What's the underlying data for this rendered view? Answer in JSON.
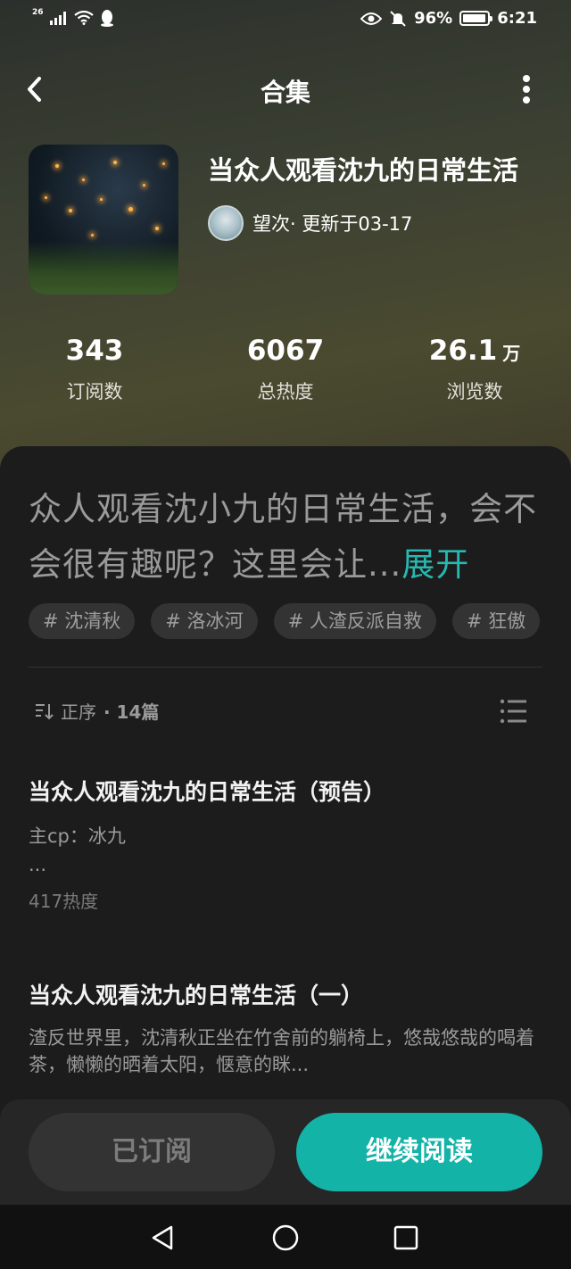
{
  "status_bar": {
    "network": "26",
    "battery_percent": "96%",
    "battery_level": 0.96,
    "time": "6:21",
    "icons": [
      "signal-icon",
      "wifi-icon",
      "qq-icon",
      "eye-icon",
      "mute-bell-icon",
      "battery-icon"
    ]
  },
  "header": {
    "back_icon": "chevron-left-icon",
    "title": "合集",
    "more_icon": "more-vertical-icon"
  },
  "collection": {
    "title": "当众人观看沈九的日常生活",
    "author": "望次",
    "updated": "· 更新于03-17"
  },
  "stats": [
    {
      "value": "343",
      "unit": "",
      "label": "订阅数"
    },
    {
      "value": "6067",
      "unit": "",
      "label": "总热度"
    },
    {
      "value": "26.1",
      "unit": "万",
      "label": "浏览数"
    }
  ],
  "description": {
    "text": "众人观看沈小九的日常生活，会不会很有趣呢？这里会让...",
    "expand": "展开"
  },
  "tags": [
    "# 沈清秋",
    "# 洛冰河",
    "# 人渣反派自救",
    "# 狂傲"
  ],
  "list_header": {
    "sort_label": "正序",
    "count": "· 14篇"
  },
  "chapters": [
    {
      "title": "当众人观看沈九的日常生活（预告）",
      "line1": "主cp：冰九",
      "line2": "...",
      "heat": "417热度"
    },
    {
      "title": "当众人观看沈九的日常生活（一）",
      "line1": "渣反世界里，沈清秋正坐在竹舍前的躺椅上，悠哉悠哉的喝着茶，懒懒的晒着太阳，惬意的眯..."
    }
  ],
  "actions": {
    "subscribed": "已订阅",
    "continue": "继续阅读"
  },
  "colors": {
    "accent": "#14b3a8",
    "expand": "#27b8b0"
  }
}
